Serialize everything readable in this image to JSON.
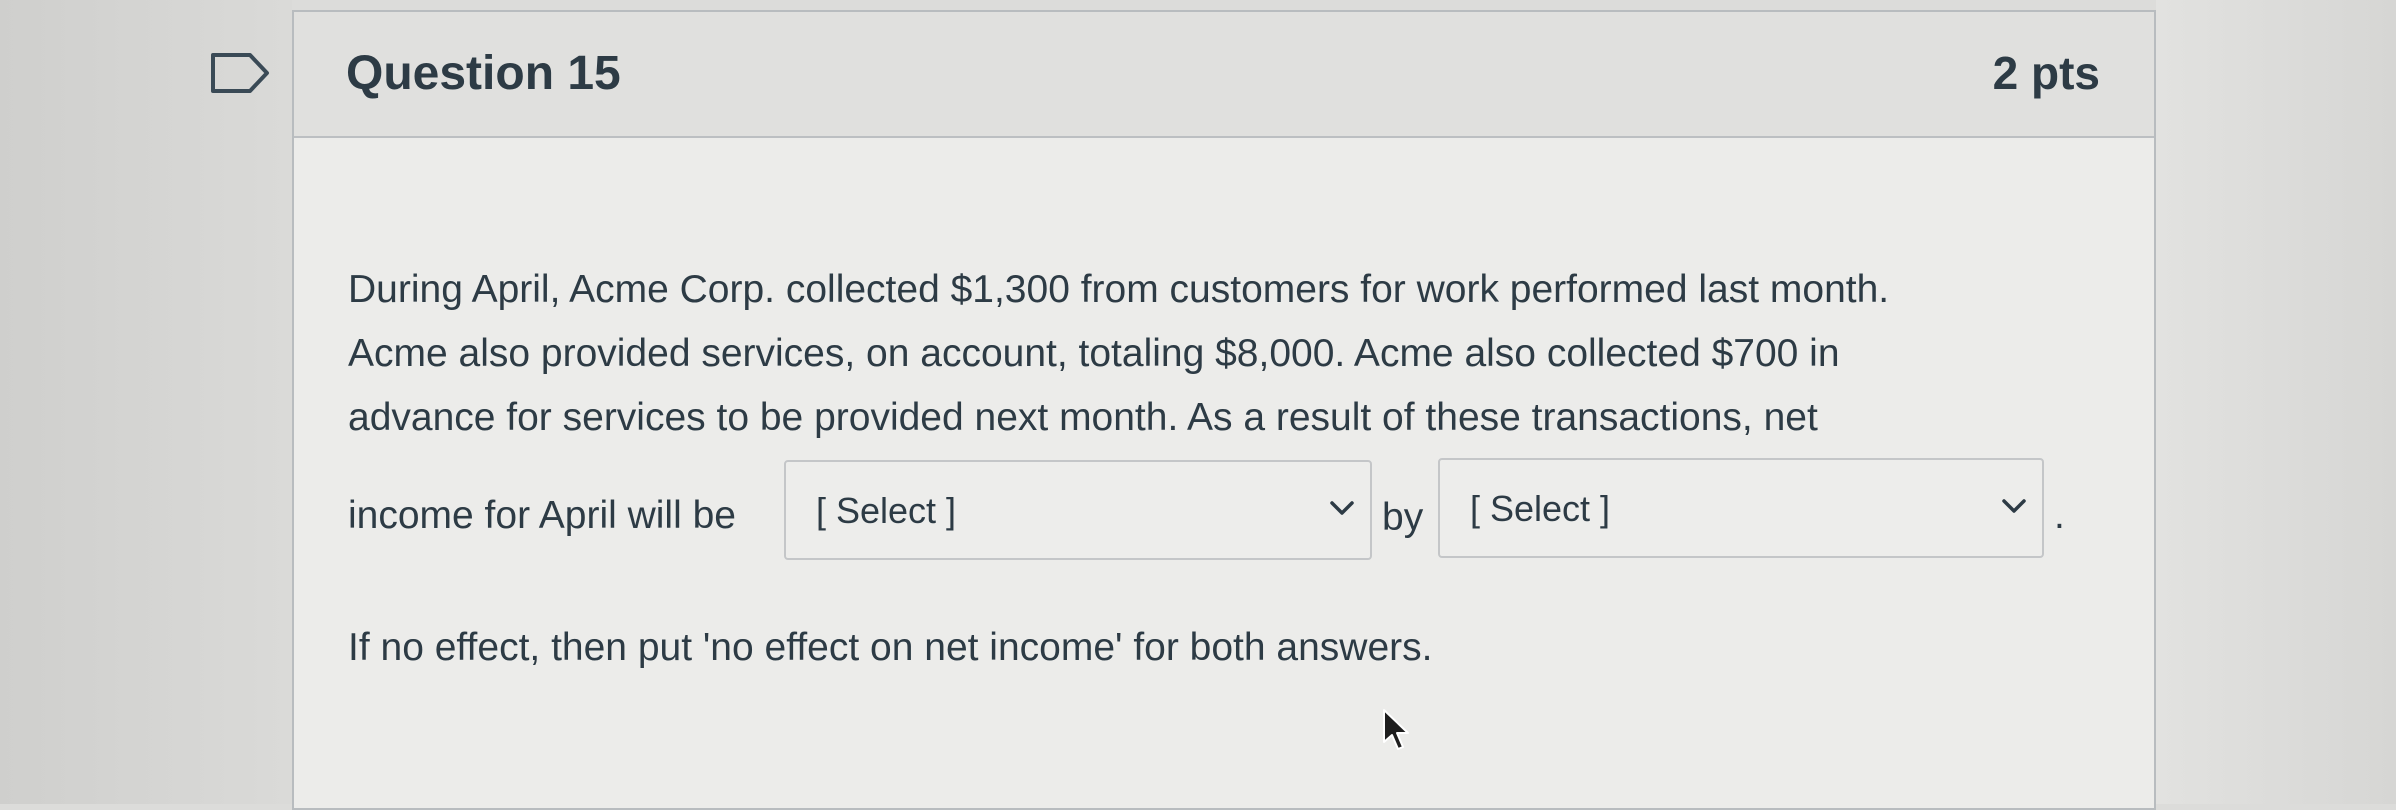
{
  "question": {
    "title": "Question 15",
    "points": "2 pts",
    "paragraph_lines": [
      "During April, Acme Corp. collected $1,300 from customers for work performed last month.",
      "Acme also provided services, on account, totaling $8,000.  Acme also collected $700 in",
      "advance for services to be provided next month.  As a result of these transactions, net"
    ],
    "prefix_label": "income for April will be",
    "connector_label": "by",
    "end_punctuation": ".",
    "dropdown_1": {
      "selected": "[ Select ]"
    },
    "dropdown_2": {
      "selected": "[ Select ]"
    },
    "note": "If no effect, then put 'no effect on net income' for both answers."
  },
  "icons": [
    "flag-icon",
    "chevron-down-icon",
    "mouse-cursor-icon"
  ],
  "colors": {
    "text": "#2d3b45",
    "header_bg": "#e0e0de",
    "body_bg": "#ececea",
    "border": "#b8bcbf"
  }
}
